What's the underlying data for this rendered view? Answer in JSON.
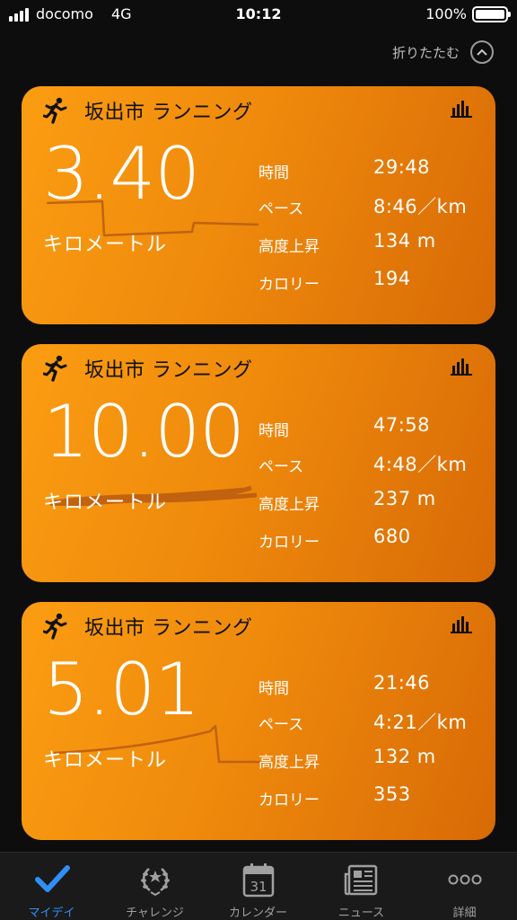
{
  "status_bar": {
    "carrier": "docomo",
    "network": "4G",
    "time": "10:12",
    "battery": "100%"
  },
  "collapse": {
    "label": "折りたたむ"
  },
  "workouts": [
    {
      "title": "坂出市 ランニング",
      "distance": "3.40",
      "unit": "キロメートル",
      "metrics": [
        {
          "label": "時間",
          "value": "29:48"
        },
        {
          "label": "ペース",
          "value": "8:46／km"
        },
        {
          "label": "高度上昇",
          "value": "134 m"
        },
        {
          "label": "カロリー",
          "value": "194"
        }
      ]
    },
    {
      "title": "坂出市 ランニング",
      "distance": "10.00",
      "unit": "キロメートル",
      "metrics": [
        {
          "label": "時間",
          "value": "47:58"
        },
        {
          "label": "ペース",
          "value": "4:48／km"
        },
        {
          "label": "高度上昇",
          "value": "237 m"
        },
        {
          "label": "カロリー",
          "value": "680"
        }
      ]
    },
    {
      "title": "坂出市 ランニング",
      "distance": "5.01",
      "unit": "キロメートル",
      "metrics": [
        {
          "label": "時間",
          "value": "21:46"
        },
        {
          "label": "ペース",
          "value": "4:21／km"
        },
        {
          "label": "高度上昇",
          "value": "132 m"
        },
        {
          "label": "カロリー",
          "value": "353"
        }
      ]
    }
  ],
  "tabbar": {
    "tabs": [
      {
        "label": "マイデイ",
        "icon": "checkmark-icon",
        "active": true
      },
      {
        "label": "チャレンジ",
        "icon": "laurel-icon",
        "active": false
      },
      {
        "label": "カレンダー",
        "icon": "calendar-icon",
        "active": false,
        "calendar_day": "31"
      },
      {
        "label": "ニュース",
        "icon": "newspaper-icon",
        "active": false
      },
      {
        "label": "詳細",
        "icon": "more-icon",
        "active": false
      }
    ]
  },
  "colors": {
    "card_start": "#fb9d12",
    "card_end": "#d86a06",
    "active_tab": "#2f8ff7",
    "route_line": "#b85a10"
  }
}
